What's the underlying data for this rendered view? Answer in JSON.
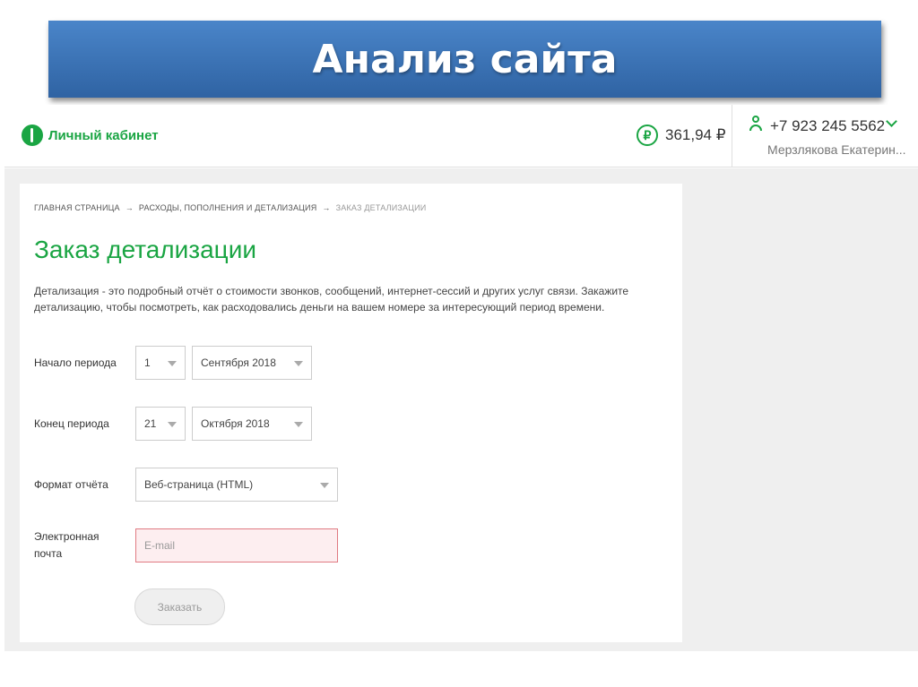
{
  "slide": {
    "title": "Анализ сайта"
  },
  "header": {
    "logo_text": "Личный кабинет",
    "balance": "361,94 ₽",
    "currency_icon": "₽",
    "phone": "+7 923 245 5562",
    "user_name": "Мерзлякова Екатерин..."
  },
  "breadcrumb": {
    "items": [
      "ГЛАВНАЯ СТРАНИЦА",
      "РАСХОДЫ, ПОПОЛНЕНИЯ И ДЕТАЛИЗАЦИЯ",
      "ЗАКАЗ ДЕТАЛИЗАЦИИ"
    ],
    "separator": "→"
  },
  "page": {
    "title": "Заказ детализации",
    "description": "Детализация - это подробный отчёт о стоимости звонков, сообщений, интернет-сессий и других услуг связи. Закажите детализацию, чтобы посмотреть, как расходовались деньги на вашем номере за интересующий период времени."
  },
  "form": {
    "start_label": "Начало периода",
    "start_day": "1",
    "start_month": "Сентября 2018",
    "end_label": "Конец периода",
    "end_day": "21",
    "end_month": "Октября 2018",
    "format_label": "Формат отчёта",
    "format_value": "Веб-страница (HTML)",
    "email_label": "Электронная почта",
    "email_placeholder": "E-mail",
    "submit_label": "Заказать"
  },
  "colors": {
    "brand_green": "#1aa543",
    "banner_blue": "#3a72b6",
    "error_red": "#e07a82"
  }
}
